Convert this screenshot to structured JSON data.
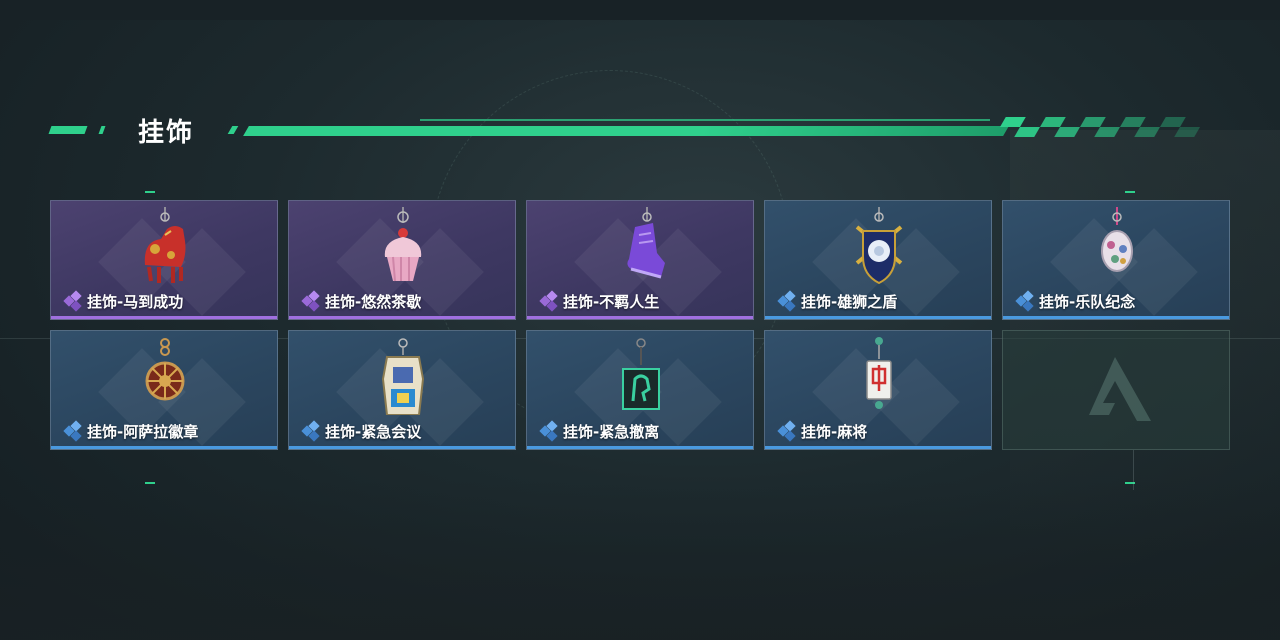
{
  "section_title": "挂饰",
  "colors": {
    "accent": "#2fd08c",
    "rarity_purple": "#a070e0",
    "rarity_blue": "#4a9ae0"
  },
  "items": [
    {
      "label": "挂饰-马到成功",
      "rarity": "purple",
      "icon": "horse-charm-icon"
    },
    {
      "label": "挂饰-悠然茶歇",
      "rarity": "purple",
      "icon": "cupcake-charm-icon"
    },
    {
      "label": "挂饰-不羁人生",
      "rarity": "purple",
      "icon": "sneaker-charm-icon"
    },
    {
      "label": "挂饰-雄狮之盾",
      "rarity": "blue",
      "icon": "lion-shield-charm-icon"
    },
    {
      "label": "挂饰-乐队纪念",
      "rarity": "blue",
      "icon": "band-badge-charm-icon"
    },
    {
      "label": "挂饰-阿萨拉徽章",
      "rarity": "blue",
      "icon": "medallion-charm-icon"
    },
    {
      "label": "挂饰-紧急会议",
      "rarity": "blue",
      "icon": "meeting-charm-icon"
    },
    {
      "label": "挂饰-紧急撤离",
      "rarity": "blue",
      "icon": "evac-charm-icon"
    },
    {
      "label": "挂饰-麻将",
      "rarity": "blue",
      "icon": "mahjong-charm-icon"
    }
  ],
  "empty_slot": {
    "icon": "game-logo-icon"
  }
}
